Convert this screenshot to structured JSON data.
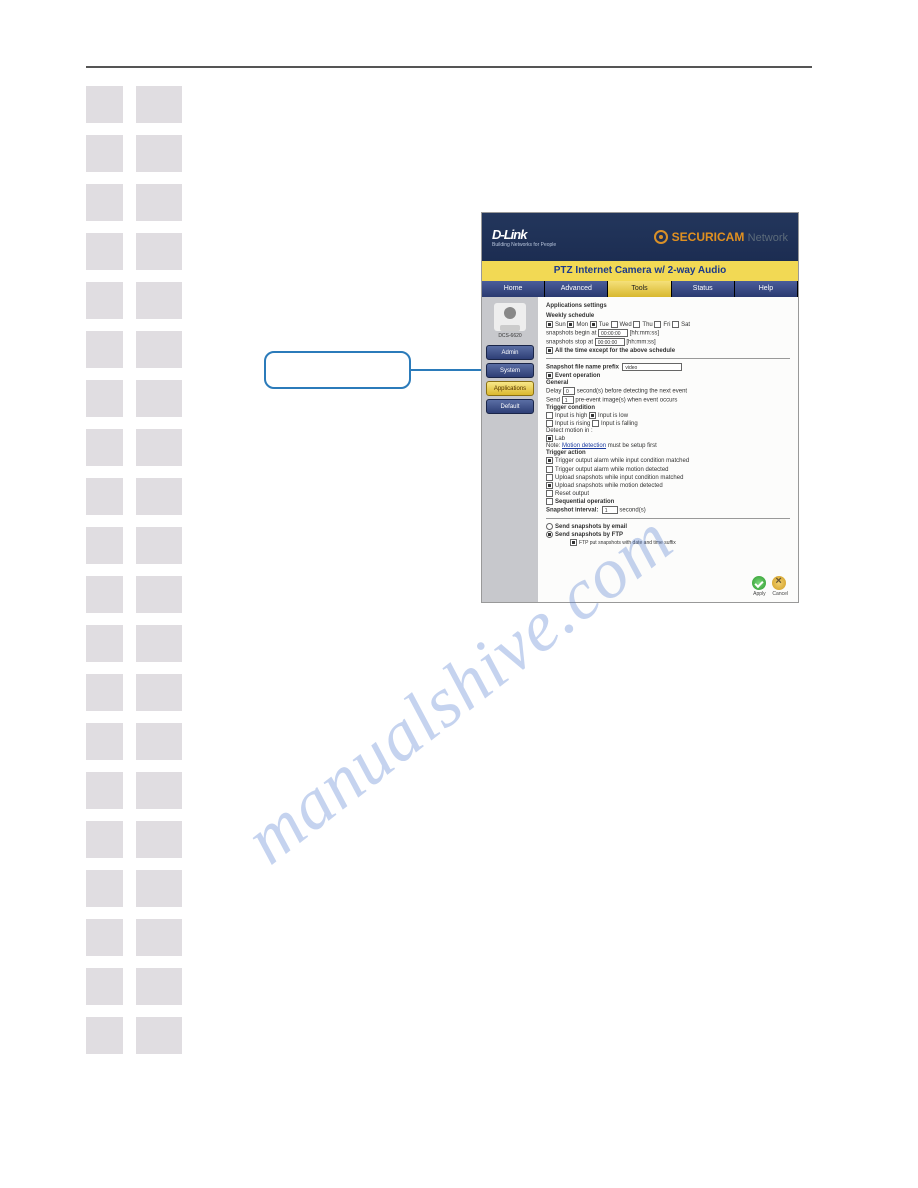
{
  "watermark": "manualshive.com",
  "callout_label": "",
  "screenshot": {
    "brand": "D-Link",
    "brand_sub": "Building Networks for People",
    "securicam": "SECURICAM",
    "network_word": "Network",
    "yellow_title": "PTZ Internet Camera w/ 2-way Audio",
    "nav": [
      "Home",
      "Advanced",
      "Tools",
      "Status",
      "Help"
    ],
    "nav_active": 2,
    "camera_model": "DCS-6620",
    "left_buttons": [
      "Admin",
      "System",
      "Applications",
      "Default"
    ],
    "left_active": 2,
    "settings_title": "Applications settings",
    "weekly_schedule": "Weekly schedule",
    "days": [
      "Sun",
      "Mon",
      "Tue",
      "Wed",
      "Thu",
      "Fri",
      "Sat"
    ],
    "days_checked": [
      true,
      true,
      true,
      false,
      false,
      false,
      false
    ],
    "begin_label": "snapshots begin at",
    "begin_value": "00:00:00",
    "begin_hint": "[hh:mm:ss]",
    "stop_label": "snapshots stop at",
    "stop_value": "00:00:00",
    "stop_hint": "[hh:mm:ss]",
    "alltime_label": "All the time except for the above schedule",
    "prefix_label": "Snapshot file name prefix",
    "prefix_value": "video",
    "event_op": "Event operation",
    "general": "General",
    "delay_pre": "Delay",
    "delay_val": "0",
    "delay_post": "second(s) before detecting the next event",
    "send_pre": "Send",
    "send_val": "1",
    "send_post": "pre-event image(s) when event occurs",
    "trigger_cond": "Trigger condition",
    "cond": [
      "Input is high",
      "Input is low",
      "Input is rising",
      "Input is falling"
    ],
    "cond_checked": [
      false,
      true,
      false,
      false
    ],
    "detect_label": "Detect motion in :",
    "lab_label": "Lab",
    "motion_note_pre": "Note:",
    "motion_link": "Motion detection",
    "motion_note_post": "must be setup first",
    "trigger_action": "Trigger action",
    "actions": [
      "Trigger output alarm while input condition matched",
      "Trigger output alarm while motion detected",
      "Upload snapshots while input condition matched",
      "Upload snapshots while motion detected"
    ],
    "actions_checked": [
      true,
      false,
      false,
      true
    ],
    "reset_output": "Reset output",
    "sequential": "Sequential operation",
    "snapshot_interval": "Snapshot interval:",
    "interval_val": "1",
    "interval_unit": "second(s)",
    "send_email": "Send snapshots by email",
    "send_ftp": "Send snapshots by FTP",
    "send_ftp_checked": true,
    "ftp_suffix": "FTP put snapshots with date and time suffix",
    "apply": "Apply",
    "cancel": "Cancel"
  }
}
